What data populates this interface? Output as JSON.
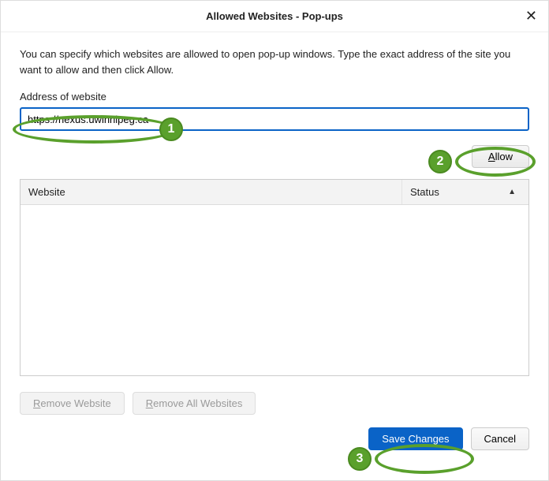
{
  "dialog": {
    "title": "Allowed Websites - Pop-ups"
  },
  "intro_text": "You can specify which websites are allowed to open pop-up windows. Type the exact address of the site you want to allow and then click Allow.",
  "address": {
    "label": "Address of website",
    "value": "https://nexus.uwinnipeg.ca"
  },
  "buttons": {
    "allow_prefix": "A",
    "allow_rest": "llow",
    "remove_website_prefix": "R",
    "remove_website_rest": "emove Website",
    "remove_all_prefix": "R",
    "remove_all_rest": "emove All Websites",
    "save": "Save Changes",
    "cancel": "Cancel"
  },
  "table": {
    "col_website": "Website",
    "col_status": "Status",
    "rows": []
  },
  "annotations": {
    "step1": "1",
    "step2": "2",
    "step3": "3"
  }
}
